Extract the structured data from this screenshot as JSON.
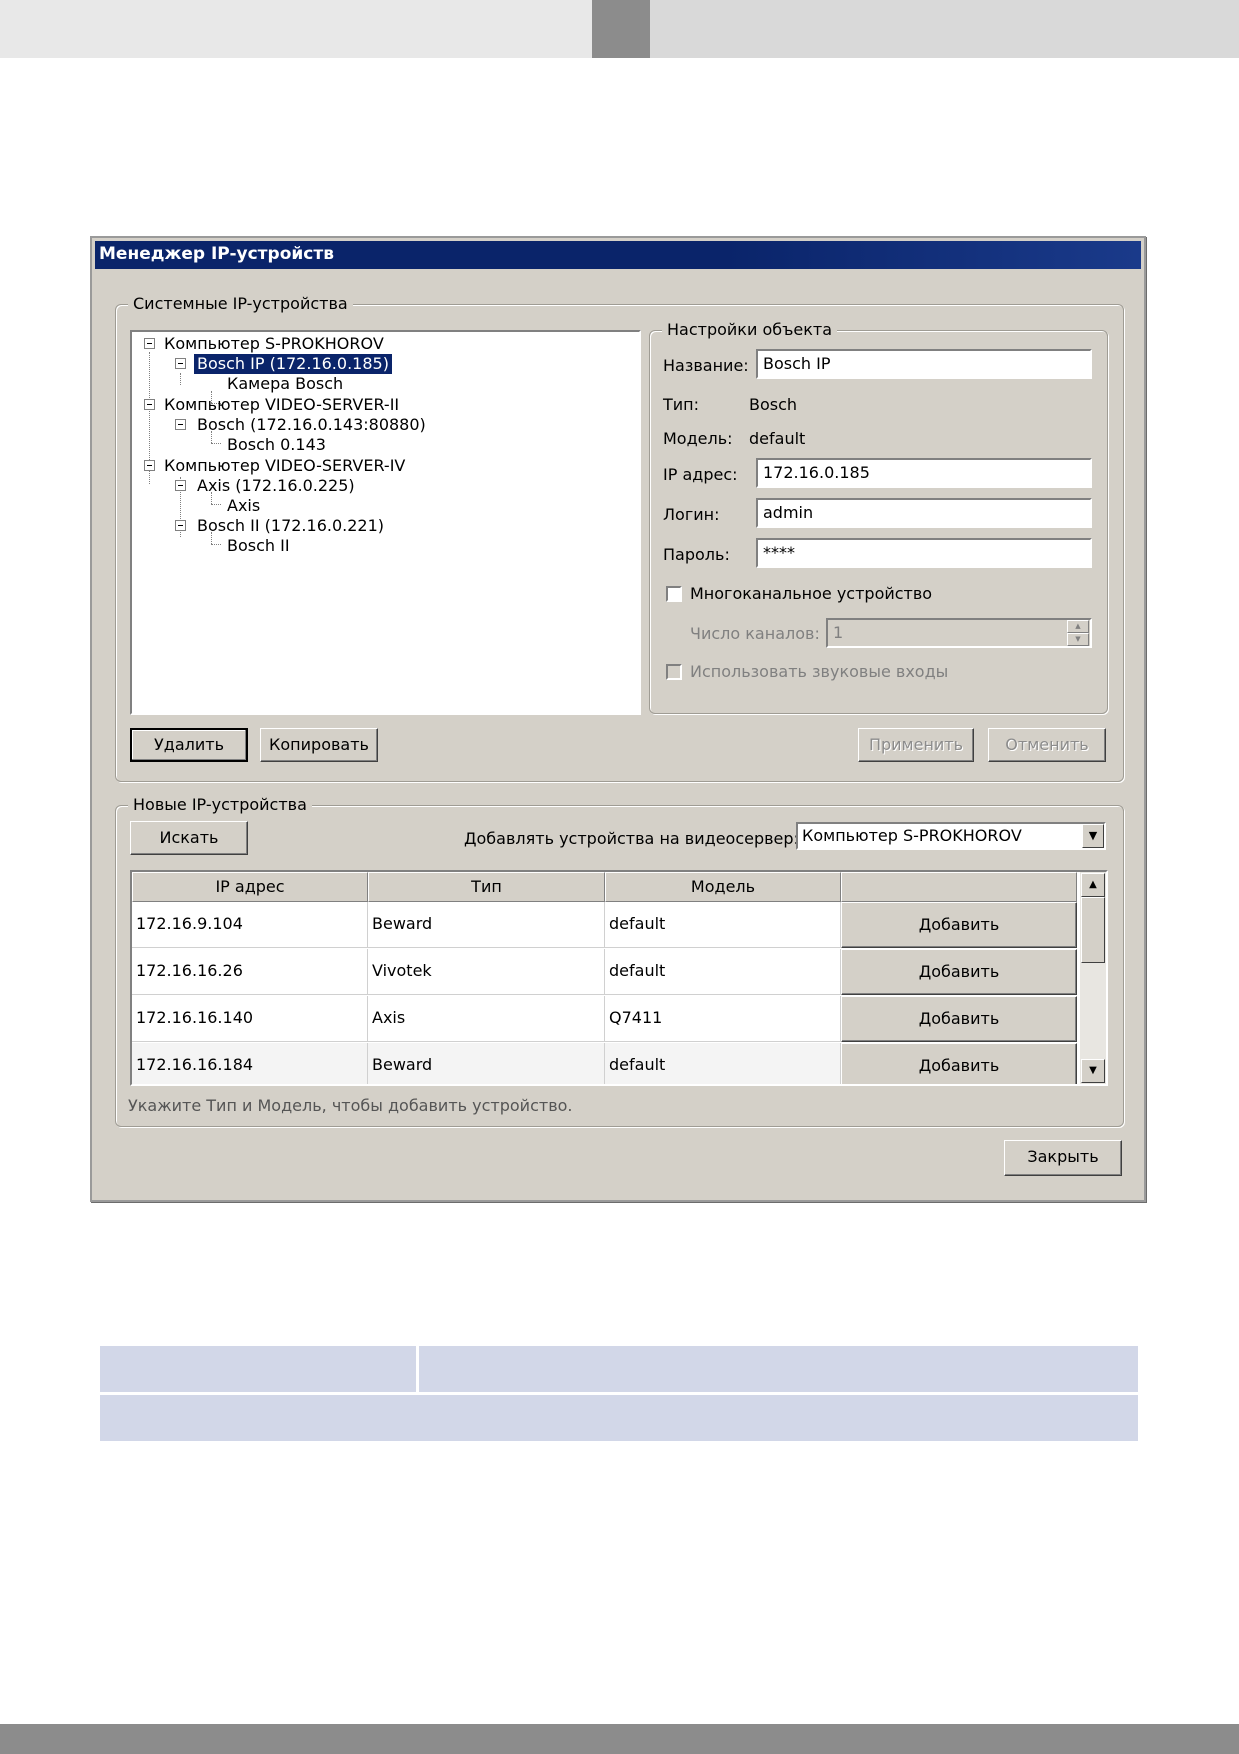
{
  "dialog": {
    "title": "Менеджер IP-устройств",
    "system_group": {
      "legend": "Системные IP-устройства",
      "tree": [
        {
          "label": "Компьютер S-PROKHOROV"
        },
        {
          "label": "Bosch IP (172.16.0.185)",
          "selected": true
        },
        {
          "label": "Камера Bosch"
        },
        {
          "label": "Компьютер VIDEO-SERVER-II"
        },
        {
          "label": "Bosch (172.16.0.143:80880)"
        },
        {
          "label": "Bosch 0.143"
        },
        {
          "label": "Компьютер VIDEO-SERVER-IV"
        },
        {
          "label": "Axis (172.16.0.225)"
        },
        {
          "label": "Axis"
        },
        {
          "label": "Bosch II (172.16.0.221)"
        },
        {
          "label": "Bosch II"
        }
      ],
      "settings": {
        "legend": "Настройки объекта",
        "name_label": "Название:",
        "name_value": "Bosch IP",
        "type_label": "Тип:",
        "type_value": "Bosch",
        "model_label": "Модель:",
        "model_value": "default",
        "ip_label": "IP адрес:",
        "ip_value": "172.16.0.185",
        "login_label": "Логин:",
        "login_value": "admin",
        "password_label": "Пароль:",
        "password_value": "****",
        "multichannel_label": "Многоканальное устройство",
        "channels_label": "Число каналов:",
        "channels_value": "1",
        "audio_label": "Использовать звуковые входы"
      },
      "buttons": {
        "delete": "Удалить",
        "copy": "Копировать",
        "apply": "Применить",
        "cancel": "Отменить"
      }
    },
    "new_group": {
      "legend": "Новые IP-устройства",
      "search_button": "Искать",
      "server_label": "Добавлять устройства на видеосервер:",
      "server_value": "Компьютер S-PROKHOROV",
      "columns": [
        "IP адрес",
        "Тип",
        "Модель",
        ""
      ],
      "rows": [
        {
          "ip": "172.16.9.104",
          "type": "Beward",
          "model": "default",
          "action": "Добавить"
        },
        {
          "ip": "172.16.16.26",
          "type": "Vivotek",
          "model": "default",
          "action": "Добавить"
        },
        {
          "ip": "172.16.16.140",
          "type": "Axis",
          "model": "Q7411",
          "action": "Добавить"
        },
        {
          "ip": "172.16.16.184",
          "type": "Beward",
          "model": "default",
          "action": "Добавить"
        }
      ],
      "hint": "Укажите Тип и Модель, чтобы добавить устройство."
    },
    "close_button": "Закрыть"
  },
  "icons": {
    "scroll_up": "▲",
    "scroll_down": "▼",
    "dropdown": "▼",
    "spin_up": "▲",
    "spin_down": "▼"
  },
  "colors": {
    "titlebar": "#0a246a",
    "selection": "#0a246a",
    "dialog_bg": "#d4d0c8",
    "table_cell": "#d2d7e8",
    "header_mid": "#8c8c8c"
  }
}
